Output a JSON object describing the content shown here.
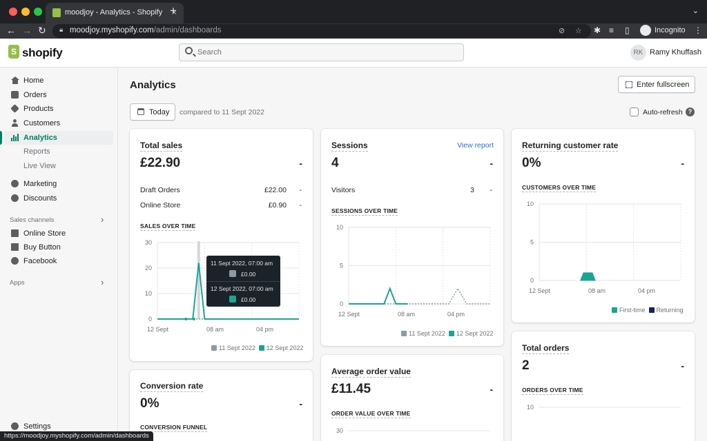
{
  "browser": {
    "tab_title": "moodjoy - Analytics - Shopify",
    "url_host": "moodjoy.myshopify.com",
    "url_path": "/admin/dashboards",
    "profile_label": "Incognito",
    "status_url": "https://moodjoy.myshopify.com/admin/dashboards"
  },
  "topbar": {
    "logo": "shopify",
    "search_placeholder": "Search",
    "avatar_initials": "RK",
    "user_name": "Ramy Khuffash"
  },
  "sidebar": {
    "items": [
      {
        "label": "Home",
        "icon": "home-icon"
      },
      {
        "label": "Orders",
        "icon": "orders-icon"
      },
      {
        "label": "Products",
        "icon": "tag-icon"
      },
      {
        "label": "Customers",
        "icon": "person-icon"
      },
      {
        "label": "Analytics",
        "icon": "bar-chart-icon",
        "active": true
      },
      {
        "label": "Marketing",
        "icon": "target-icon"
      },
      {
        "label": "Discounts",
        "icon": "discount-icon"
      }
    ],
    "sub_items": [
      "Reports",
      "Live View"
    ],
    "sales_channels_label": "Sales channels",
    "channels": [
      {
        "label": "Online Store",
        "icon": "store-icon"
      },
      {
        "label": "Buy Button",
        "icon": "buy-button-icon"
      },
      {
        "label": "Facebook",
        "icon": "facebook-icon"
      }
    ],
    "apps_label": "Apps",
    "settings_label": "Settings"
  },
  "page": {
    "title": "Analytics",
    "fullscreen_label": "Enter fullscreen",
    "date_label": "Today",
    "compared_text": "compared to 11 Sept 2022",
    "auto_refresh_label": "Auto-refresh",
    "help_glyph": "?"
  },
  "cards": {
    "total_sales": {
      "title": "Total sales",
      "value": "£22.90",
      "change": "-",
      "rows": [
        {
          "label": "Draft Orders",
          "value": "£22.00",
          "change": "-"
        },
        {
          "label": "Online Store",
          "value": "£0.90",
          "change": "-"
        }
      ],
      "chart_title": "SALES OVER TIME",
      "tooltip": {
        "rows": [
          {
            "date": "11 Sept 2022, 07:00 am",
            "value": "£0.00"
          },
          {
            "date": "12 Sept 2022, 07:00 am",
            "value": "£0.00"
          }
        ]
      }
    },
    "sessions": {
      "title": "Sessions",
      "link": "View report",
      "value": "4",
      "change": "-",
      "rows": [
        {
          "label": "Visitors",
          "value": "3",
          "change": "-"
        }
      ],
      "chart_title": "SESSIONS OVER TIME"
    },
    "returning": {
      "title": "Returning customer rate",
      "value": "0%",
      "change": "-",
      "chart_title": "CUSTOMERS OVER TIME"
    },
    "conversion": {
      "title": "Conversion rate",
      "value": "0%",
      "change": "-",
      "chart_title": "CONVERSION FUNNEL"
    },
    "aov": {
      "title": "Average order value",
      "value": "£11.45",
      "change": "-",
      "chart_title": "ORDER VALUE OVER TIME"
    },
    "total_orders": {
      "title": "Total orders",
      "value": "2",
      "change": "-",
      "chart_title": "ORDERS OVER TIME"
    }
  },
  "colors": {
    "accent": "#008060",
    "series_current": "#1ba491",
    "series_previous": "#8c9aa6",
    "returning": "#1c1f5c"
  },
  "chart_data": [
    {
      "type": "line",
      "title": "SALES OVER TIME",
      "x_ticks": [
        "12 Sept",
        "08 am",
        "04 pm"
      ],
      "y_ticks": [
        "0",
        "10",
        "20",
        "30"
      ],
      "ylim": [
        0,
        30
      ],
      "series": [
        {
          "name": "11 Sept 2022",
          "color": "#8c9aa6",
          "hours": [
            0,
            24
          ],
          "values": [
            0,
            0
          ]
        },
        {
          "name": "12 Sept 2022",
          "color": "#1ba491",
          "hours": [
            0,
            6,
            7,
            8,
            24
          ],
          "values": [
            0,
            0,
            22,
            0,
            0
          ]
        }
      ],
      "tooltip_hour": 7
    },
    {
      "type": "line",
      "title": "SESSIONS OVER TIME",
      "x_ticks": [
        "12 Sept",
        "08 am",
        "04 pm"
      ],
      "y_ticks": [
        "0",
        "5",
        "10"
      ],
      "ylim": [
        0,
        10
      ],
      "series": [
        {
          "name": "11 Sept 2022",
          "color": "#8c9aa6",
          "hours": [
            0,
            17,
            18.5,
            20,
            24
          ],
          "values": [
            0,
            0,
            2,
            0,
            0
          ]
        },
        {
          "name": "12 Sept 2022",
          "color": "#1ba491",
          "hours": [
            0,
            6,
            7,
            8,
            10
          ],
          "values": [
            0,
            0,
            2,
            0,
            0
          ]
        }
      ]
    },
    {
      "type": "area",
      "title": "CUSTOMERS OVER TIME",
      "x_ticks": [
        "12 Sept",
        "08 am",
        "04 pm"
      ],
      "y_ticks": [
        "0",
        "5",
        "10"
      ],
      "ylim": [
        0,
        10
      ],
      "series": [
        {
          "name": "First-time",
          "color": "#1ba491",
          "hours": [
            7,
            7.5,
            9,
            9.5
          ],
          "values": [
            0,
            1,
            1,
            0
          ]
        },
        {
          "name": "Returning",
          "color": "#1c1f5c",
          "hours": [],
          "values": []
        }
      ]
    },
    {
      "type": "line",
      "title": "ORDER VALUE OVER TIME",
      "y_ticks": [
        "30"
      ],
      "series": []
    },
    {
      "type": "line",
      "title": "ORDERS OVER TIME",
      "y_ticks": [
        "10"
      ],
      "series": []
    }
  ]
}
